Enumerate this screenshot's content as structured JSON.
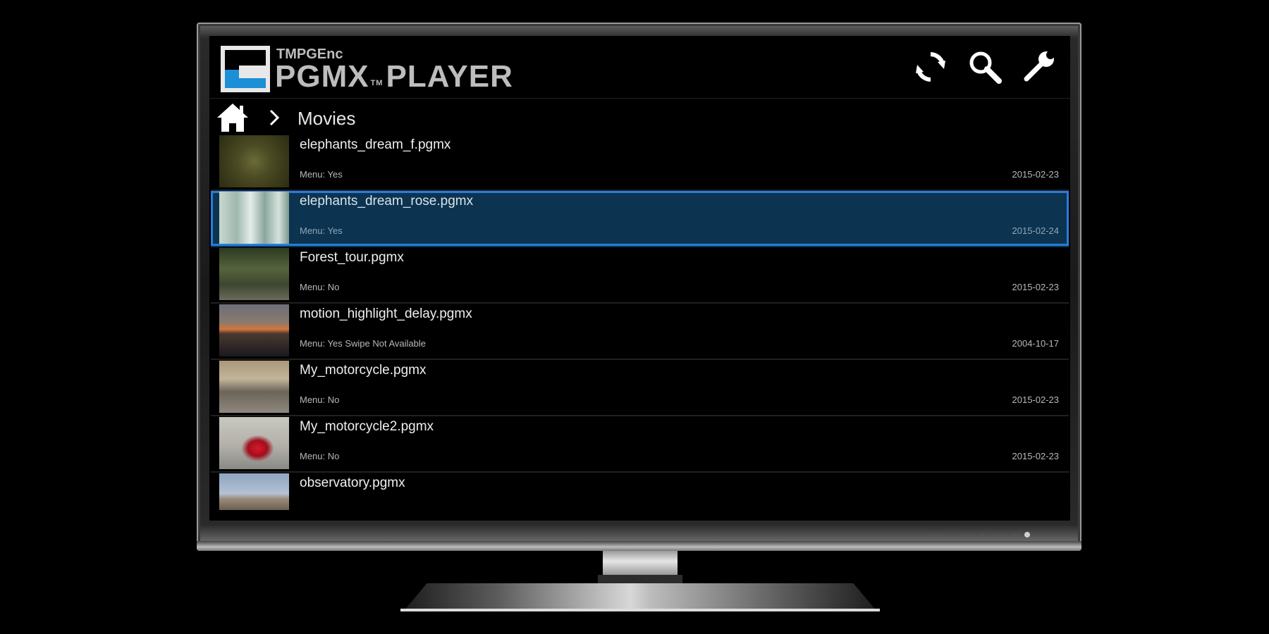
{
  "app": {
    "brand_small": "TMPGEnc",
    "brand_main": "PGMX",
    "brand_tm": "TM",
    "brand_player": "PLAYER",
    "accent_color": "#2a7be0",
    "selection_bg": "#0c3450"
  },
  "header_actions": [
    {
      "icon": "refresh-icon"
    },
    {
      "icon": "search-icon"
    },
    {
      "icon": "wrench-icon"
    }
  ],
  "breadcrumb": {
    "home_icon": "home-icon",
    "separator_icon": "chevron-right-icon",
    "current": "Movies"
  },
  "files": [
    {
      "name": "elephants_dream_f.pgmx",
      "menu": "Menu: Yes",
      "date": "2015-02-23",
      "selected": false
    },
    {
      "name": "elephants_dream_rose.pgmx",
      "menu": "Menu: Yes",
      "date": "2015-02-24",
      "selected": true
    },
    {
      "name": "Forest_tour.pgmx",
      "menu": "Menu: No",
      "date": "2015-02-23",
      "selected": false
    },
    {
      "name": "motion_highlight_delay.pgmx",
      "menu": "Menu: Yes  Swipe Not Available",
      "date": "2004-10-17",
      "selected": false
    },
    {
      "name": "My_motorcycle.pgmx",
      "menu": "Menu: No",
      "date": "2015-02-23",
      "selected": false
    },
    {
      "name": "My_motorcycle2.pgmx",
      "menu": "Menu: No",
      "date": "2015-02-23",
      "selected": false
    },
    {
      "name": "observatory.pgmx",
      "menu": "",
      "date": "",
      "selected": false
    }
  ]
}
